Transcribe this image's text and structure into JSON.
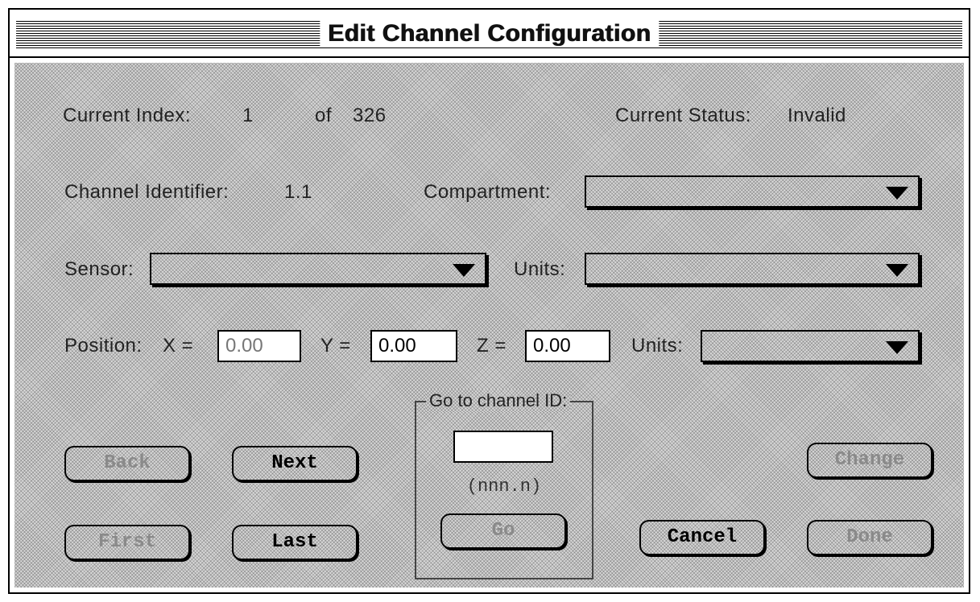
{
  "window": {
    "title": "Edit Channel Configuration"
  },
  "index": {
    "label": "Current Index:",
    "value": "1",
    "of_label": "of",
    "total": "326"
  },
  "status": {
    "label": "Current Status:",
    "value": "Invalid"
  },
  "channel": {
    "label": "Channel Identifier:",
    "value": "1.1"
  },
  "compartment": {
    "label": "Compartment:",
    "selected": ""
  },
  "sensor": {
    "label": "Sensor:",
    "selected": ""
  },
  "sensor_units": {
    "label": "Units:",
    "selected": ""
  },
  "position": {
    "label": "Position:",
    "x_label": "X =",
    "x_value": "0.00",
    "y_label": "Y =",
    "y_value": "0.00",
    "z_label": "Z =",
    "z_value": "0.00",
    "units_label": "Units:",
    "units_selected": ""
  },
  "goto": {
    "legend": "Go to channel ID:",
    "value": "",
    "hint": "(nnn.n)",
    "button": "Go"
  },
  "buttons": {
    "back": "Back",
    "next": "Next",
    "first": "First",
    "last": "Last",
    "change": "Change",
    "cancel": "Cancel",
    "done": "Done"
  },
  "colors": {
    "window_bg": "#d8d8d8",
    "frame": "#000000",
    "disabled_text": "#8a8a8a"
  }
}
